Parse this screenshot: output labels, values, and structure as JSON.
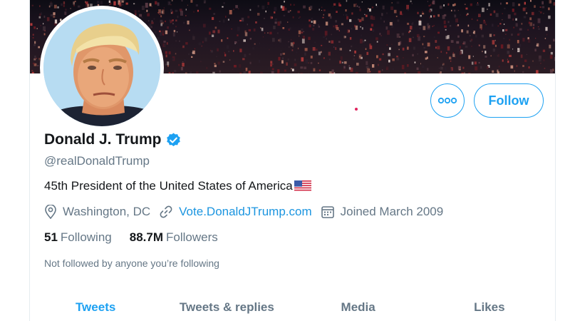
{
  "profile": {
    "display_name": "Donald J. Trump",
    "handle": "@realDonaldTrump",
    "bio": "45th President of the United States of America",
    "bio_flag_icon": "us-flag-icon",
    "verified_icon": "verified-badge-icon",
    "location": "Washington, DC",
    "website": "Vote.DonaldJTrump.com",
    "joined": "Joined March 2009",
    "following_count": "51",
    "following_label": "Following",
    "followers_count": "88.7M",
    "followers_label": "Followers",
    "followed_by_notice": "Not followed by anyone you’re following"
  },
  "actions": {
    "more_icon": "more-options-icon",
    "follow_label": "Follow"
  },
  "tabs": [
    {
      "label": "Tweets",
      "active": true
    },
    {
      "label": "Tweets & replies",
      "active": false
    },
    {
      "label": "Media",
      "active": false
    },
    {
      "label": "Likes",
      "active": false
    }
  ],
  "colors": {
    "accent": "#1da1f2",
    "link": "#1b95e0",
    "secondary_text": "#657786",
    "primary_text": "#14171a"
  }
}
